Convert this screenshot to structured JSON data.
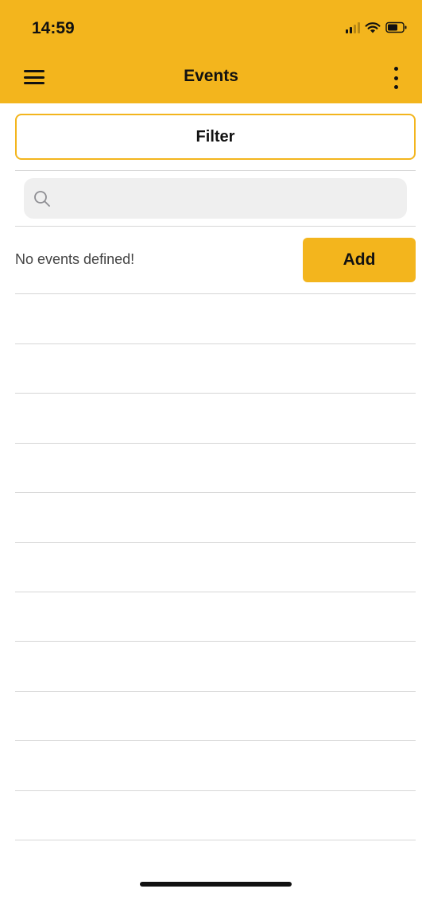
{
  "status_bar": {
    "time": "14:59",
    "signal_icon": "signal-icon",
    "wifi_icon": "wifi-icon",
    "battery_icon": "battery-icon"
  },
  "nav": {
    "title": "Events",
    "menu_icon": "hamburger-menu-icon",
    "more_icon": "vertical-ellipsis-icon"
  },
  "filter": {
    "label": "Filter"
  },
  "search": {
    "placeholder": "",
    "value": "",
    "icon": "search-icon"
  },
  "events": {
    "empty_message": "No events defined!",
    "add_label": "Add"
  },
  "colors": {
    "accent": "#F3B51D",
    "search_bg": "#EFEFEF",
    "divider": "#D6D6D6"
  }
}
